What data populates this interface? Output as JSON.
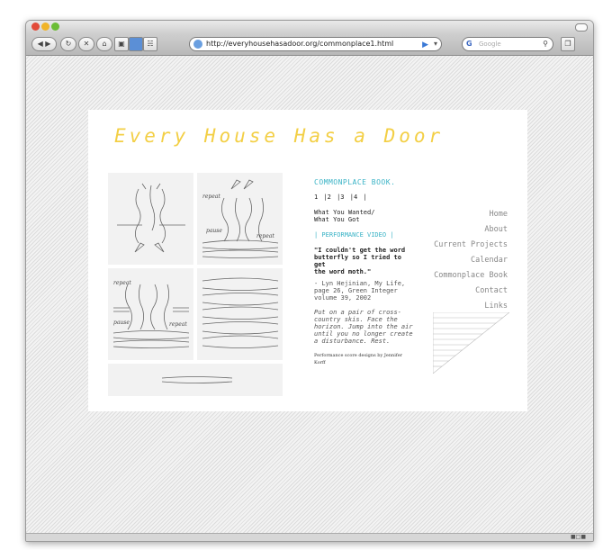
{
  "browser": {
    "url": "http://everyhousehasadoor.org/commonplace1.html",
    "search_placeholder": "Google",
    "search_engine": "G"
  },
  "site": {
    "title": "Every House Has a Door"
  },
  "commonplace": {
    "heading": "COMMONPLACE BOOK.",
    "pages": [
      "1",
      "|2",
      "|3",
      "|4",
      "|"
    ],
    "what_line1": "What You Wanted/",
    "what_line2": "What You Got",
    "video": "| PERFORMANCE VIDEO |",
    "quote_line1": "\"I couldn't get the word",
    "quote_line2": "butterfly so I tried to get",
    "quote_line3": "the word moth.\"",
    "cite_line1": "- Lyn Hejinian, My Life,",
    "cite_line2": "page 26, Green Integer",
    "cite_line3": "volume 39, 2002",
    "poem_line1": "Put on a pair of cross-",
    "poem_line2": "country skis. Face the",
    "poem_line3": "horizon. Jump into the air",
    "poem_line4": "until you no longer create",
    "poem_line5": "a disturbance. Rest.",
    "credit": "Performance score designs by Jennifer Korff"
  },
  "nav": {
    "home": "Home",
    "about": "About",
    "current_projects": "Current Projects",
    "calendar": "Calendar",
    "commonplace_book": "Commonplace Book",
    "contact": "Contact",
    "links": "Links"
  },
  "score_text": {
    "repeat": "repeat",
    "pause": "pause"
  },
  "colors": {
    "title": "#f3cf45",
    "accent": "#3ab3c6",
    "nav": "#888888"
  }
}
